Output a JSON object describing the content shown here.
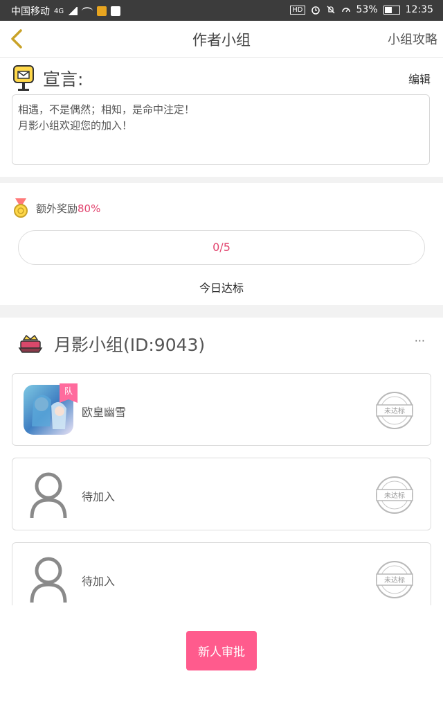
{
  "status_bar": {
    "carrier": "中国移动",
    "network": "4G",
    "battery": "53%",
    "time": "12:35",
    "hd": "HD",
    "icons": [
      "signal-icon",
      "wifi-icon",
      "app-icon",
      "app-icon",
      "hd-icon",
      "alarm-icon",
      "mute-icon",
      "speed-icon",
      "battery-icon"
    ]
  },
  "navbar": {
    "title": "作者小组",
    "right_link": "小组攻略",
    "back_icon": "back-chevron-icon",
    "accent": "#c9a227"
  },
  "declaration": {
    "label": "宣言:",
    "edit": "编辑",
    "line1": "相遇，不是偶然；相知，是命中注定！",
    "line2": "月影小组欢迎您的加入！"
  },
  "bonus": {
    "label": "额外奖励",
    "percent": "80%",
    "progress_text": "0/5",
    "progress_fraction": 0,
    "daily_label": "今日达标"
  },
  "group": {
    "name": "月影小组(ID:9043)",
    "more": "···",
    "members": [
      {
        "name": "欧皇幽雪",
        "badge": "队",
        "stamp": "未达标",
        "has_avatar": true
      },
      {
        "name": "待加入",
        "stamp": "未达标",
        "has_avatar": false
      },
      {
        "name": "待加入",
        "stamp": "未达标",
        "has_avatar": false
      }
    ]
  },
  "approve_button": "新人审批",
  "colors": {
    "pink": "#ff5b8d",
    "red_text": "#e2456f",
    "status_bar": "#3c3c3c"
  }
}
